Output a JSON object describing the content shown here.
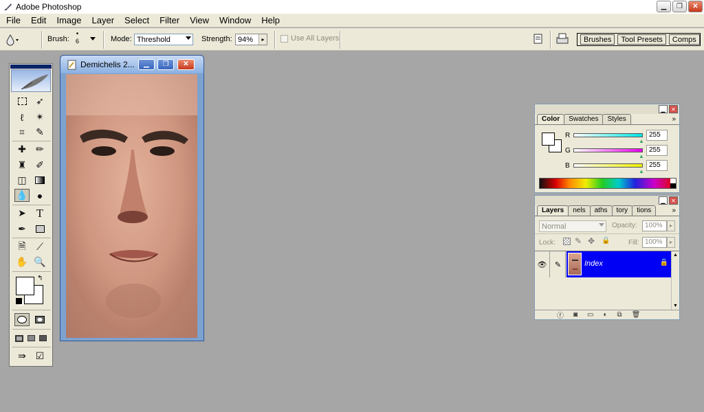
{
  "app": {
    "title": "Adobe Photoshop"
  },
  "menu": [
    "File",
    "Edit",
    "Image",
    "Layer",
    "Select",
    "Filter",
    "View",
    "Window",
    "Help"
  ],
  "options": {
    "brush_label": "Brush:",
    "brush_size": "6",
    "mode_label": "Mode:",
    "mode_value": "Threshold",
    "strength_label": "Strength:",
    "strength_value": "94%",
    "use_all_layers": "Use All Layers"
  },
  "well": {
    "brushes": "Brushes",
    "tool_presets": "Tool Presets",
    "comps": "Comps"
  },
  "document": {
    "title": "Demichelis 2..."
  },
  "color_panel": {
    "tabs": [
      "Color",
      "Swatches",
      "Styles"
    ],
    "r_label": "R",
    "g_label": "G",
    "b_label": "B",
    "r": "255",
    "g": "255",
    "b": "255",
    "r_color": "#00e5e5",
    "g_color": "#e800e8",
    "b_color": "#f0f000"
  },
  "layers_panel": {
    "tabs": [
      "Layers",
      "nels",
      "aths",
      "tory",
      "tions"
    ],
    "blend_mode": "Normal",
    "opacity_label": "Opacity:",
    "opacity": "100%",
    "lock_label": "Lock:",
    "fill_label": "Fill:",
    "fill": "100%",
    "layer_name": "Index",
    "selection_color": "#0000f5"
  },
  "colors": {
    "workspace": "#a6a6a6",
    "chrome": "#ece9d8",
    "titlebar_blue": "#0a246a"
  }
}
